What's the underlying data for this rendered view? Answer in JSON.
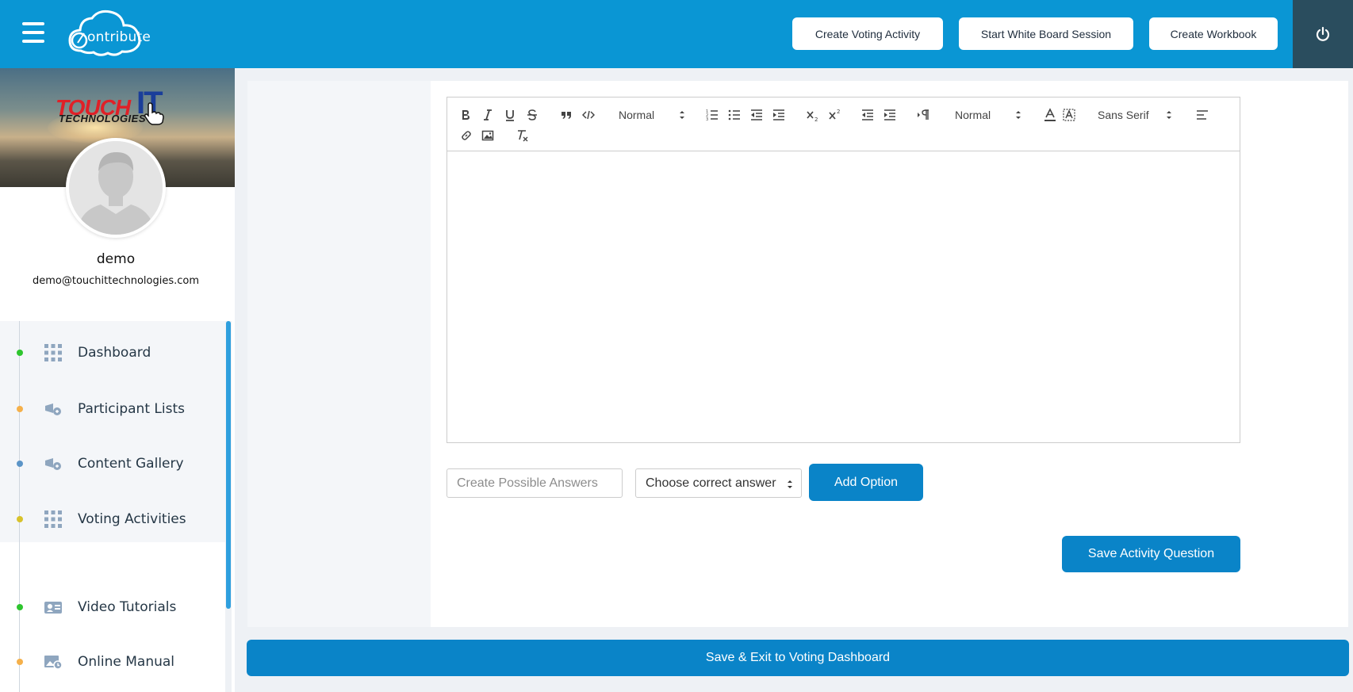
{
  "app": {
    "logo_text": "ontribute"
  },
  "header": {
    "buttons": [
      {
        "label": "Create Voting Activity"
      },
      {
        "label": "Start White Board Session"
      },
      {
        "label": "Create Workbook"
      }
    ]
  },
  "profile": {
    "banner_brand": {
      "touch": "TOUCH",
      "it": "IT",
      "tech": "TECHNOLOGIES"
    },
    "name": "demo",
    "email": "demo@touchittechnologies.com"
  },
  "sidebar": {
    "items": [
      {
        "label": "Dashboard",
        "dot_color": "#2ec52e",
        "icon": "grid-icon"
      },
      {
        "label": "Participant Lists",
        "dot_color": "#f5b04a",
        "icon": "megaphone-icon"
      },
      {
        "label": "Content Gallery",
        "dot_color": "#5b94c7",
        "icon": "megaphone-icon"
      },
      {
        "label": "Voting Activities",
        "dot_color": "#d8c22b",
        "icon": "grid-icon"
      },
      {
        "label": "Video Tutorials",
        "dot_color": "#2ec52e",
        "icon": "video-card-icon"
      },
      {
        "label": "Online Manual",
        "dot_color": "#f5b04a",
        "icon": "image-card-icon"
      }
    ]
  },
  "editor": {
    "toolbar": {
      "header_select": "Normal",
      "size_select": "Normal",
      "font_select": "Sans Serif"
    },
    "content": ""
  },
  "answers": {
    "input_placeholder": "Create Possible Answers",
    "input_value": "",
    "correct_select": "Choose correct answer",
    "add_option_label": "Add Option"
  },
  "actions": {
    "save_question_label": "Save Activity Question",
    "save_exit_label": "Save & Exit to Voting Dashboard"
  },
  "colors": {
    "header_bg": "#0a96d4",
    "power_bg": "#2a4d5e",
    "primary_button": "#0a84c8"
  }
}
